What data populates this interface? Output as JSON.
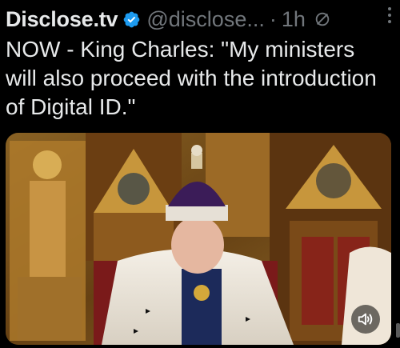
{
  "post": {
    "author": {
      "display_name": "Disclose.tv",
      "handle": "@disclose...",
      "verified": true
    },
    "separator": "·",
    "time": "1h",
    "text": "NOW - King Charles: \"My ministers will also proceed with the introduction of Digital ID.\"",
    "icons": {
      "verified": "verified-badge-icon",
      "grok": "grok-icon",
      "more": "more-options-icon",
      "sound": "speaker-icon"
    }
  },
  "colors": {
    "background": "#000000",
    "primary_text": "#e7e9ea",
    "secondary_text": "#71767b",
    "verified_blue": "#1d9bf0"
  }
}
